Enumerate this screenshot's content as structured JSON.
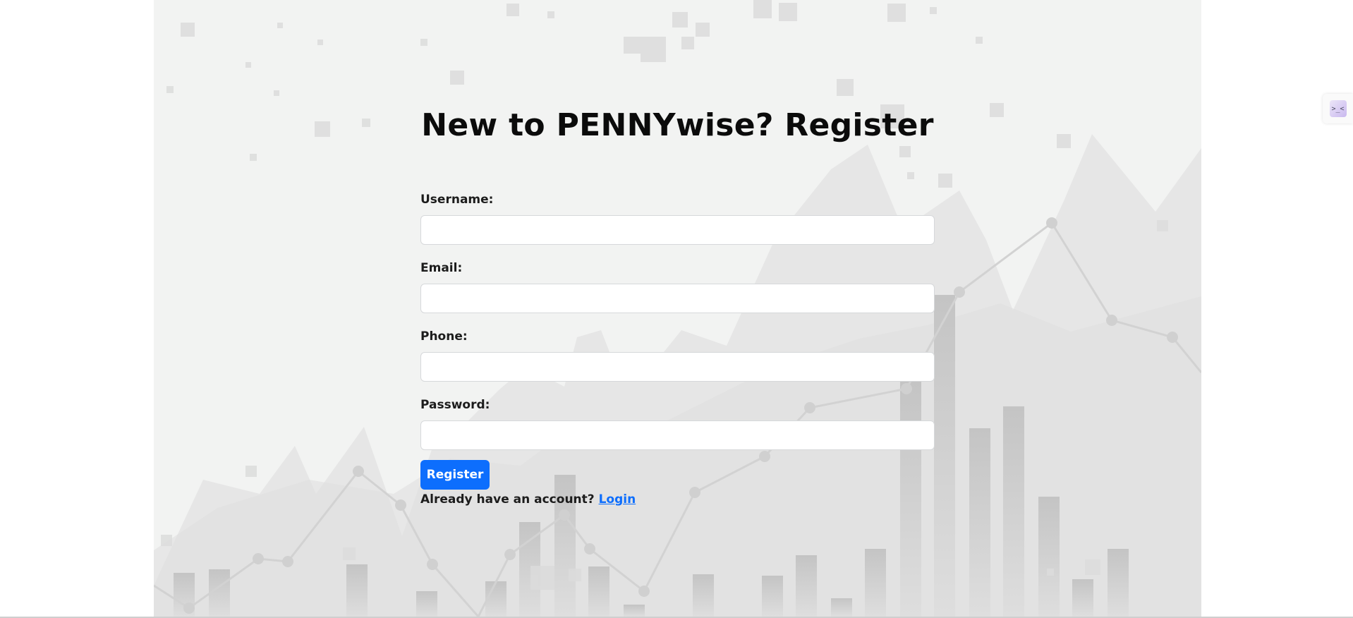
{
  "page": {
    "title": "New to PENNYwise? Register"
  },
  "form": {
    "username_label": "Username:",
    "email_label": "Email:",
    "phone_label": "Phone:",
    "password_label": "Password:",
    "username_value": "",
    "email_value": "",
    "phone_value": "",
    "password_value": "",
    "register_label": "Register"
  },
  "footer": {
    "prompt": "Already have an account? ",
    "login_label": "Login"
  },
  "side_widget": {
    "icon": "terminal-icon",
    "glyph": ">_<"
  },
  "colors": {
    "accent": "#0d6efd",
    "background_panel": "#f2f3f2"
  }
}
